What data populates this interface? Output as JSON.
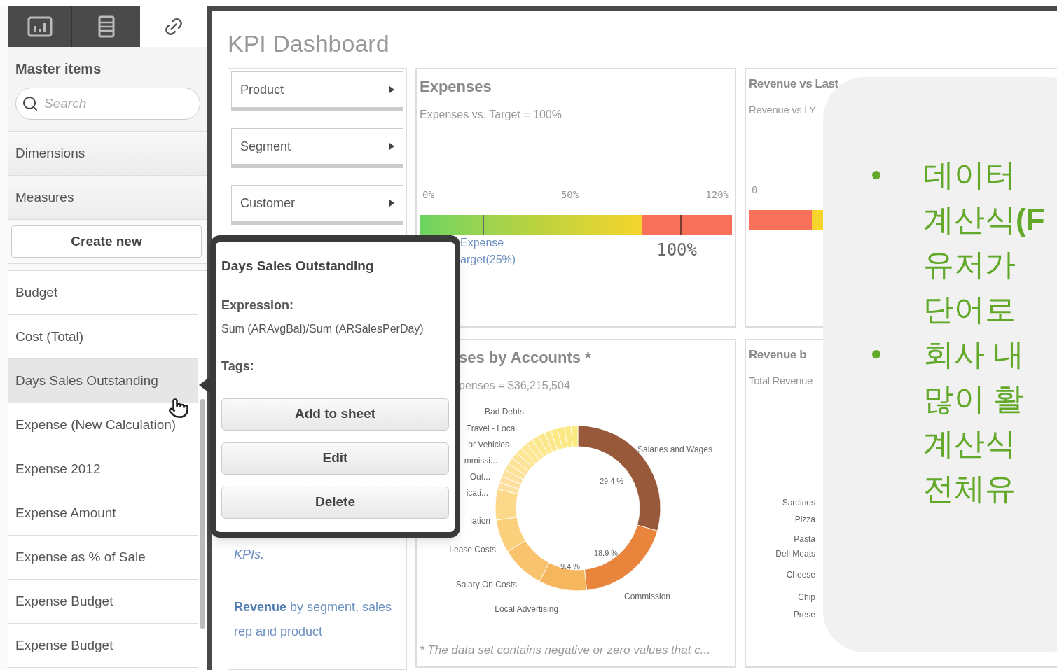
{
  "sidebar": {
    "tabs": [
      {
        "kind": "charts",
        "selected": false
      },
      {
        "kind": "list",
        "selected": false
      },
      {
        "kind": "link",
        "selected": true
      }
    ],
    "title": "Master items",
    "search": {
      "placeholder": "Search"
    },
    "sections": [
      "Dimensions",
      "Measures"
    ],
    "create_button": "Create new",
    "items": [
      {
        "label": "Budget",
        "selected": false
      },
      {
        "label": "Cost (Total)",
        "selected": false
      },
      {
        "label": "Days Sales Outstanding",
        "selected": true
      },
      {
        "label": "Expense (New Calculation)",
        "selected": false
      },
      {
        "label": "Expense 2012",
        "selected": false
      },
      {
        "label": "Expense Amount",
        "selected": false
      },
      {
        "label": "Expense as % of Sale",
        "selected": false
      },
      {
        "label": "Expense Budget",
        "selected": false
      },
      {
        "label": "Expense Budget",
        "selected": false
      }
    ]
  },
  "popup": {
    "title": "Days Sales Outstanding",
    "expression_label": "Expression:",
    "expression": "Sum (ARAvgBal)/Sum (ARSalesPerDay)",
    "tags_label": "Tags:",
    "buttons": [
      "Add to sheet",
      "Edit",
      "Delete"
    ]
  },
  "dashboard": {
    "title": "KPI Dashboard",
    "filters": [
      "Product",
      "Segment",
      "Customer"
    ],
    "kpi_note": "KPIs.",
    "revenue_note": "**Revenue** by segment, sales rep and product",
    "expenses": {
      "title": "Expenses",
      "subtitle": "Expenses vs. Target = 100%",
      "ticks": [
        "0%",
        "50%",
        "120%"
      ],
      "level": 0.71,
      "legend": [
        "Expense",
        "arget(25%)"
      ],
      "value": "100%"
    },
    "revenue_vs_last": {
      "title": "Revenue vs Last",
      "subtitle": "Revenue vs LY",
      "tick": "0"
    },
    "accounts": {
      "title": "ses by Accounts *",
      "subtitle": "penses = $36,215,504",
      "left_labels": [
        "Bad Debts",
        "Travel - Local",
        "or Vehicles",
        "mmissi...",
        "Out...",
        "icati...",
        "iation",
        "Lease Costs",
        "Salary On Costs",
        "Local Advertising"
      ],
      "right_labels": [
        "Salaries and Wages",
        "Commission"
      ],
      "percents": [
        "29.4 %",
        "18.9 %",
        "9.4 %"
      ],
      "footnote": "* The data set contains negative or zero values that c..."
    },
    "revenue_by": {
      "title": "Revenue b",
      "subtitle": "Total Revenue",
      "labels": [
        "Sardines",
        "Pizza",
        "Pasta",
        "Deli Meats",
        "Cheese",
        "Chip",
        "Prese"
      ]
    }
  },
  "callout": {
    "bullets": [
      {
        "lines": [
          "데이터",
          "계산식**(F**",
          "유저가",
          "단어로"
        ]
      },
      {
        "lines": [
          "회사 내",
          "많이 활",
          "계산식",
          "전체유"
        ]
      }
    ]
  }
}
